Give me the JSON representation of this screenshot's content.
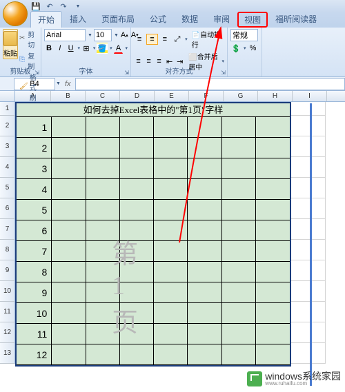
{
  "qat": {
    "save": "💾",
    "undo": "↶",
    "redo": "↷"
  },
  "tabs": [
    "开始",
    "插入",
    "页面布局",
    "公式",
    "数据",
    "审阅",
    "视图",
    "福昕阅读器"
  ],
  "active_tab": 0,
  "highlighted_tab": 6,
  "ribbon": {
    "clipboard": {
      "label": "剪贴板",
      "paste": "粘贴",
      "cut": "剪切",
      "copy": "复制",
      "format": "格式刷"
    },
    "font": {
      "label": "字体",
      "name": "Arial",
      "size": "10"
    },
    "align": {
      "label": "对齐方式",
      "wrap": "自动换行",
      "merge": "合并后居中"
    },
    "number": {
      "label": "",
      "general": "常规",
      "percent": "%"
    }
  },
  "namebox": "B4",
  "fx": "fx",
  "columns": [
    "A",
    "B",
    "C",
    "D",
    "E",
    "F",
    "G",
    "H",
    "I"
  ],
  "col_widths": {
    "A": 52,
    "std": 50
  },
  "row_count": 13,
  "sheet": {
    "title": "如何去掉Excel表格中的\"第1页\"字样",
    "numbers": [
      1,
      2,
      3,
      4,
      5,
      6,
      7,
      8,
      9,
      10,
      11,
      12
    ]
  },
  "watermark_text": "第 1 页",
  "logo": {
    "main": "windows系统家园",
    "sub": "www.ruhaifu.com"
  }
}
